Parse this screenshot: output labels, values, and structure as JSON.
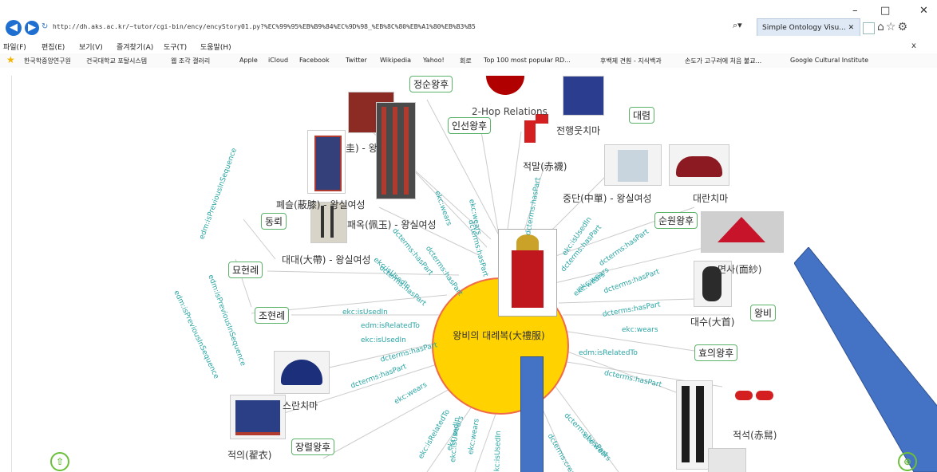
{
  "browser": {
    "url": "http://dh.aks.ac.kr/~tutor/cgi-bin/ency/encyStory01.py?%EC%99%95%EB%B9%84%EC%9D%98_%EB%8C%80%EB%A1%80%EB%B3%B5",
    "tab_title": "Simple Ontology Visu...",
    "search_icon": "search-icon",
    "window_controls": [
      "–",
      "□",
      "✕"
    ],
    "close_tab": "x"
  },
  "menu": [
    "파일(F)",
    "편집(E)",
    "보기(V)",
    "즐겨찾기(A)",
    "도구(T)",
    "도움말(H)"
  ],
  "favorites": [
    "한국학중앙연구원",
    "건국대학교 포탈시스템",
    "웹 조각 갤러리",
    "Apple",
    "iCloud",
    "Facebook",
    "Twitter",
    "Wikipedia",
    "Yahoo!",
    "회로",
    "Top 100 most popular RD...",
    "후백제 견훤 - 지식백과",
    "손도가 고구려에 처음 불교...",
    "Google Cultural Institute"
  ],
  "graph": {
    "center": "왕비의 대례복(大禮服)",
    "overlay_text": "2-Hop Relations",
    "box_nodes": {
      "n1": "정순왕후",
      "n2": "인선왕후",
      "n3": "대렴",
      "n4": "동뢰",
      "n5": "묘현례",
      "n6": "조현례",
      "n7": "순원왕후",
      "n8": "왕비",
      "n9": "효의왕후",
      "n10": "장렬왕후"
    },
    "text_nodes": {
      "t1": "전행웃치마",
      "t2": "적말(赤襪)",
      "t3": "중단(中單) - 왕실여성",
      "t4": "대란치마",
      "t5": "폐슬(蔽膝) - 왕실여성",
      "t6": "패옥(佩玉) - 왕실여성",
      "t7": "대대(大帶) - 왕실여성",
      "t8": "면사(面紗)",
      "t9": "대수(大首)",
      "t10": "적석(赤舃)",
      "t11": "적의(翟衣)",
      "t12": "스란치마",
      "t13": "圭) - 왕"
    },
    "edges": {
      "e1": "ekc:isUsedIn",
      "e2": "edm:isRelatedTo",
      "e3": "ekc:isUsedIn",
      "e4": "dcterms:hasPart",
      "e5": "dcterms:hasPart",
      "e6": "ekc:wears",
      "e7": "dcterms:hasPart",
      "e8": "dcterms:hasPart",
      "e9": "ekc:wears",
      "e10": "dcterms:hasPart",
      "e11": "ekc:isUsedIn",
      "e12": "dcterms:hasPart",
      "e13": "ekc:wears",
      "e14": "dcterms:hasPart",
      "e15": "dcterms:hasPart",
      "e16": "ekc:wears",
      "e17": "edm:isRelatedTo",
      "e18": "dcterms:hasPart",
      "e19": "dcterms:hasPart",
      "e20": "dcterms:hasPart",
      "e21": "ekc:wears",
      "e22": "edm:isPreviousInSequence",
      "e23": "edm:isPreviousInSequence",
      "e24": "edm:isPreviousInSequence",
      "e25": "ekc:isUsedIn",
      "e26": "dcterms:hasPart",
      "e27": "ekc:wears",
      "e28": "ekc:isUsedIn",
      "e29": "dcterms:hasPart",
      "e30": "ekc:wears",
      "e31": "ekc:isUsedIn",
      "e32": "dcterms:creat",
      "e33": "ekc:wears",
      "e34": "ekc:wears",
      "e35": "ekc:isRelatedTo"
    }
  },
  "controls": {
    "zoom_in": "⇧",
    "fit": "⊕"
  },
  "colors": {
    "center_fill": "#ffd200",
    "center_stroke": "#ef6b4a",
    "node_border": "#5bb36a",
    "edge_text": "#2aa4a4",
    "arrow_fill": "#4472c4"
  }
}
